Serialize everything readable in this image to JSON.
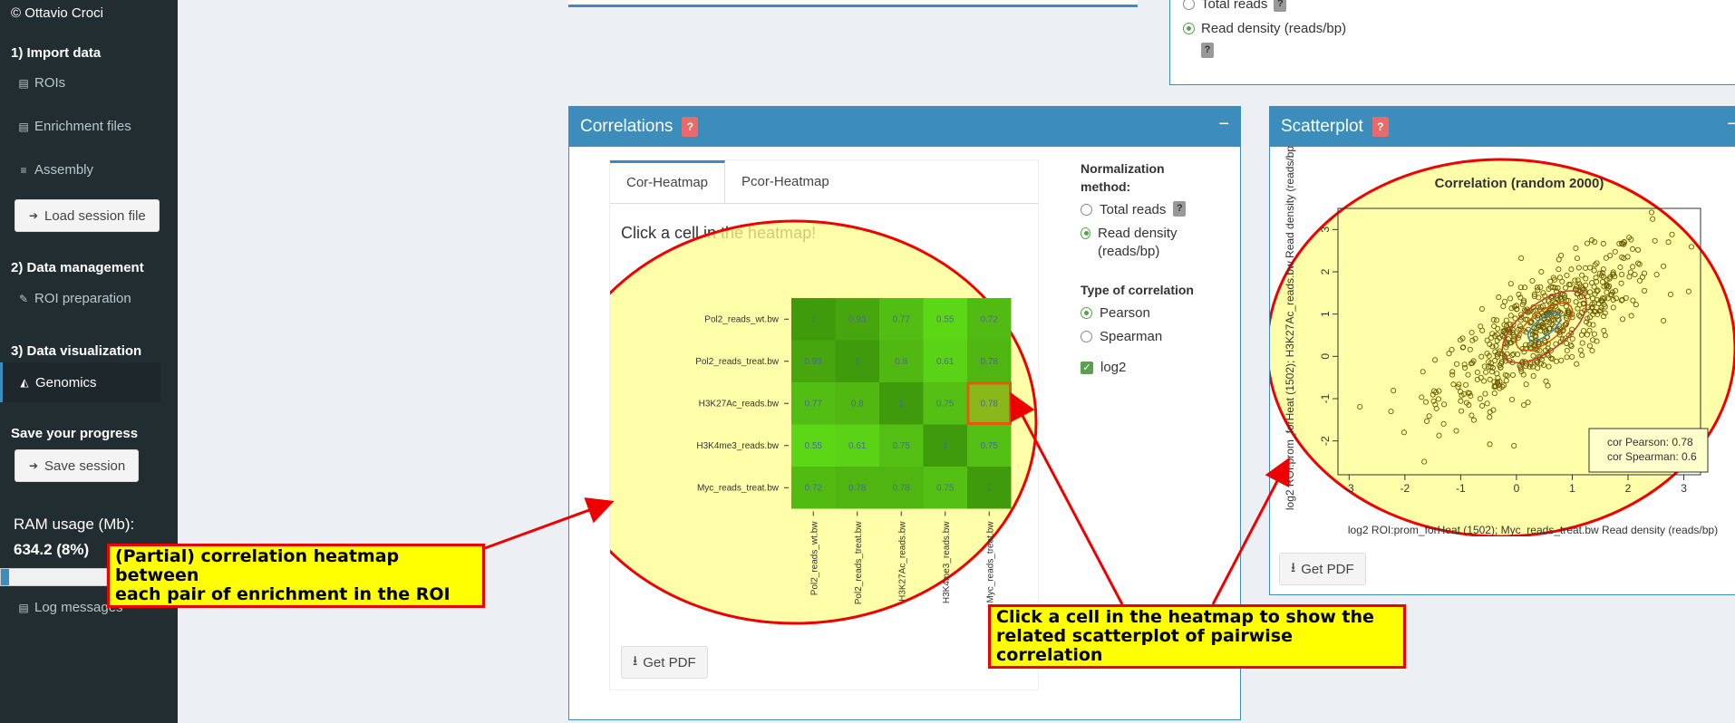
{
  "sidebar": {
    "copyright": "© Ottavio Croci",
    "sec1": "1) Import data",
    "rois": "ROIs",
    "enrichment": "Enrichment files",
    "assembly": "Assembly",
    "load_session": "Load session file",
    "sec2": "2) Data management",
    "roi_prep": "ROI preparation",
    "sec3": "3) Data visualization",
    "genomics": "Genomics",
    "save_progress": "Save your progress",
    "save_session": "Save session",
    "ram_label": "RAM usage (Mb):",
    "ram_value": "634.2 (8%)",
    "ram_fraction": 0.08,
    "log_messages": "Log messages"
  },
  "top_right": {
    "total_reads": "Total reads",
    "read_density": "Read density (reads/bp)"
  },
  "correlations": {
    "title": "Correlations",
    "help": "?",
    "minimize": "−",
    "tabs": [
      "Cor-Heatmap",
      "Pcor-Heatmap"
    ],
    "panel_title": "Click a cell in the heatmap!",
    "get_pdf": "Get PDF",
    "norm_head": "Normalization method:",
    "norm_total": "Total reads",
    "norm_density": "Read density (reads/bp)",
    "type_head": "Type of correlation",
    "pearson": "Pearson",
    "spearman": "Spearman",
    "log2": "log2"
  },
  "heatmap": {
    "labels": [
      "Pol2_reads_wt.bw",
      "Pol2_reads_treat.bw",
      "H3K27Ac_reads.bw",
      "H3K4me3_reads.bw",
      "Myc_reads_treat.bw"
    ],
    "values": [
      [
        "1",
        "0.93",
        "0.77",
        "0.55",
        "0.72"
      ],
      [
        "0.93",
        "1",
        "0.8",
        "0.61",
        "0.78"
      ],
      [
        "0.77",
        "0.8",
        "1",
        "0.75",
        "0.78"
      ],
      [
        "0.55",
        "0.61",
        "0.75",
        "1",
        "0.75"
      ],
      [
        "0.72",
        "0.78",
        "0.78",
        "0.75",
        "1"
      ]
    ],
    "colors": [
      [
        "#3f9a0c",
        "#47a50e",
        "#52bd12",
        "#5cd716",
        "#52bb12"
      ],
      [
        "#47a50e",
        "#3f9a0c",
        "#50b811",
        "#5ad215",
        "#4fb511"
      ],
      [
        "#52bd12",
        "#50b811",
        "#3f9a0c",
        "#53c013",
        "#8ab81a"
      ],
      [
        "#5cd716",
        "#5ad215",
        "#53c013",
        "#3f9a0c",
        "#53c013"
      ],
      [
        "#52bb12",
        "#4fb511",
        "#4fb511",
        "#53c013",
        "#3f9a0c"
      ]
    ]
  },
  "scatterplot": {
    "title": "Scatterplot",
    "help": "?",
    "minimize": "−",
    "get_pdf": "Get PDF"
  },
  "chart_data": {
    "type": "scatter",
    "title": "Correlation (random 2000)",
    "xlabel": "log2 ROI:prom_forHeat (1502); Myc_reads_treat.bw Read density (reads/bp)",
    "ylabel": "log2 ROI:prom_forHeat (1502); H3K27Ac_reads.bw Read density (reads/bp",
    "xticks": [
      "-3",
      "-2",
      "-1",
      "0",
      "1",
      "2",
      "3"
    ],
    "yticks": [
      "-2",
      "-1",
      "0",
      "1",
      "2",
      "3"
    ],
    "xlim": [
      -3.2,
      3.3
    ],
    "ylim": [
      -2.8,
      3.5
    ],
    "legend": [
      "cor Pearson: 0.78",
      "cor Spearman: 0.6"
    ],
    "series": [
      {
        "name": "",
        "color": "#6b5a00",
        "correlation": 0.78,
        "n": 600
      }
    ]
  },
  "annotations": {
    "left": "(Partial) correlation heatmap between\neach pair of enrichment in the ROI",
    "right": "Click a cell in the heatmap to show the\nrelated scatterplot of pairwise correlation"
  }
}
